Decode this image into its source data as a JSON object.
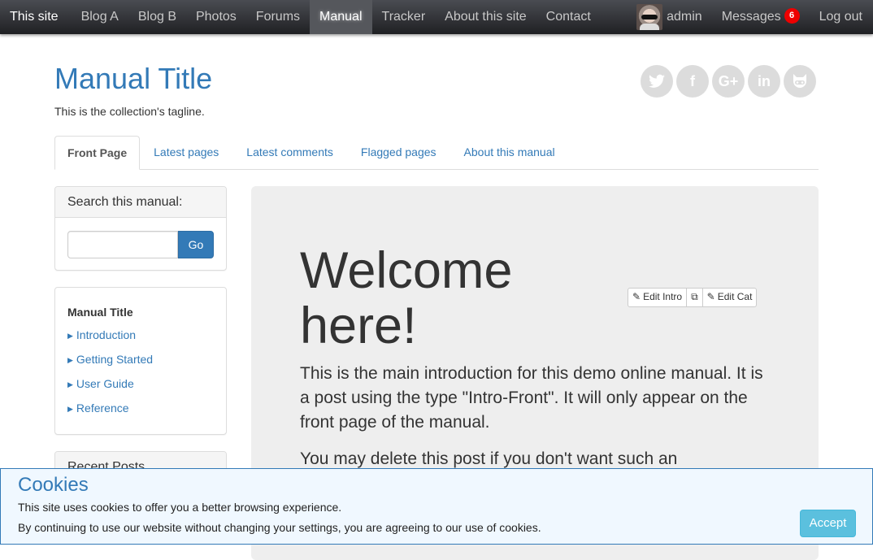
{
  "topnav": {
    "brand": "This site",
    "items": [
      {
        "label": "Blog A"
      },
      {
        "label": "Blog B"
      },
      {
        "label": "Photos"
      },
      {
        "label": "Forums"
      },
      {
        "label": "Manual",
        "active": true
      },
      {
        "label": "Tracker"
      },
      {
        "label": "About this site"
      },
      {
        "label": "Contact"
      }
    ],
    "user": "admin",
    "messages_label": "Messages",
    "messages_count": "6",
    "logout": "Log out"
  },
  "header": {
    "title": "Manual Title",
    "tagline": "This is the collection's tagline.",
    "social": [
      {
        "icon": "twitter-icon",
        "glyph": "🐦"
      },
      {
        "icon": "facebook-icon",
        "glyph": "f"
      },
      {
        "icon": "google-plus-icon",
        "glyph": "G+"
      },
      {
        "icon": "linkedin-icon",
        "glyph": "in"
      },
      {
        "icon": "github-icon",
        "glyph": "◉"
      }
    ]
  },
  "tabs": [
    {
      "label": "Front Page",
      "active": true
    },
    {
      "label": "Latest pages"
    },
    {
      "label": "Latest comments"
    },
    {
      "label": "Flagged pages"
    },
    {
      "label": "About this manual"
    }
  ],
  "sidebar": {
    "search": {
      "heading": "Search this manual:",
      "value": "",
      "button": "Go"
    },
    "toc": {
      "title": "Manual Title",
      "items": [
        {
          "label": "Introduction"
        },
        {
          "label": "Getting Started"
        },
        {
          "label": "User Guide"
        },
        {
          "label": "Reference"
        }
      ]
    },
    "recent": {
      "heading": "Recent Posts"
    }
  },
  "main": {
    "heading": "Welcome here!",
    "paragraphs": [
      "This is the main introduction for this demo online manual. It is a post using the type \"Intro-Front\". It will only appear on the front page of the manual.",
      "You may delete this post if you don't want such an"
    ],
    "edit_intro": "Edit Intro",
    "edit_cat": "Edit Cat"
  },
  "cookie": {
    "title": "Cookies",
    "line1": "This site uses cookies to offer you a better browsing experience.",
    "line2": "By continuing to use our website without changing your settings, you are agreeing to our use of cookies.",
    "accept": "Accept"
  },
  "colors": {
    "link": "#337ab7",
    "badge": "#ee0000",
    "accept_button": "#5bc0de",
    "jumbotron_bg": "#eeeeee"
  }
}
